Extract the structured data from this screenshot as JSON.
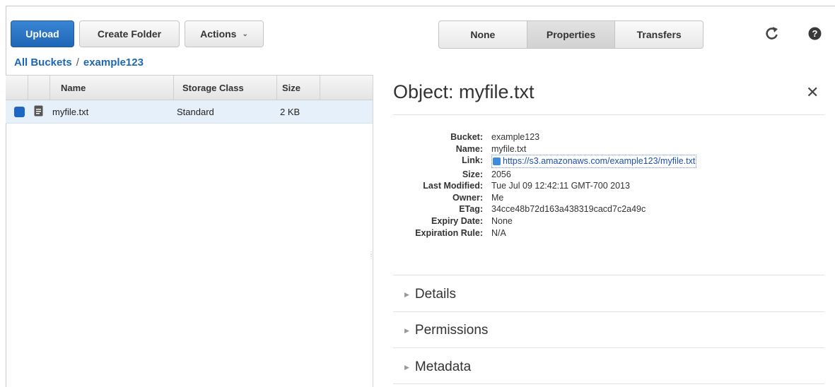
{
  "toolbar": {
    "upload": "Upload",
    "create_folder": "Create Folder",
    "actions": "Actions",
    "view_tabs": [
      "None",
      "Properties",
      "Transfers"
    ],
    "active_tab": "Properties"
  },
  "breadcrumb": {
    "root": "All Buckets",
    "separator": "/",
    "bucket": "example123"
  },
  "table": {
    "columns": [
      "Name",
      "Storage Class",
      "Size"
    ],
    "rows": [
      {
        "name": "myfile.txt",
        "storage_class": "Standard",
        "size": "2 KB"
      }
    ]
  },
  "panel": {
    "title": "Object: myfile.txt",
    "properties": [
      {
        "key": "Bucket:",
        "value": "example123"
      },
      {
        "key": "Name:",
        "value": "myfile.txt"
      },
      {
        "key": "Link:",
        "value": "https://s3.amazonaws.com/example123/myfile.txt"
      },
      {
        "key": "Size:",
        "value": "2056"
      },
      {
        "key": "Last Modified:",
        "value": "Tue Jul 09 12:42:11 GMT-700 2013"
      },
      {
        "key": "Owner:",
        "value": "Me"
      },
      {
        "key": "ETag:",
        "value": "34cce48b72d163a438319cacd7c2a49c"
      },
      {
        "key": "Expiry Date:",
        "value": "None"
      },
      {
        "key": "Expiration Rule:",
        "value": "N/A"
      }
    ],
    "sections": [
      "Details",
      "Permissions",
      "Metadata"
    ]
  },
  "colors": {
    "accent": "#1f66b6",
    "link": "#1f67b1",
    "selected_row": "#e6f0fb"
  },
  "icons": [
    "refresh-icon",
    "help-icon",
    "close-icon",
    "document-icon",
    "link-icon",
    "chevron-down-icon",
    "triangle-right-icon"
  ]
}
